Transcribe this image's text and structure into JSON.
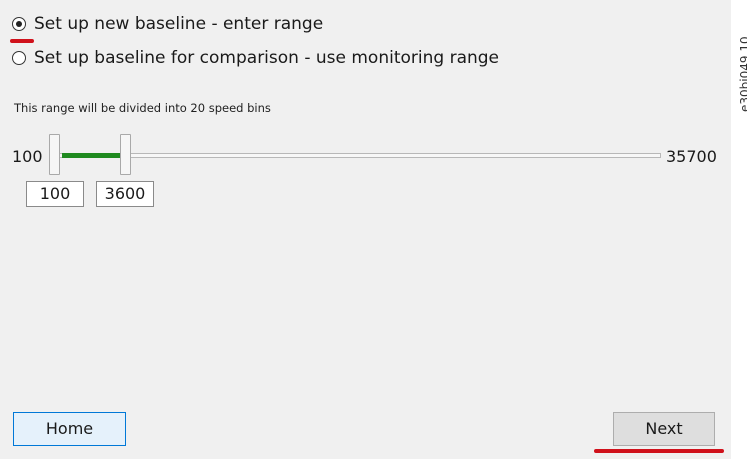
{
  "options": {
    "new_baseline_label": "Set up new baseline - enter range",
    "comparison_baseline_label": "Set up baseline for comparison - use monitoring range",
    "selected": "new_baseline"
  },
  "info_text": "This range will be divided into 20 speed bins",
  "range": {
    "min_label": "100",
    "max_label": "35700",
    "low_value": "100",
    "high_value": "3600"
  },
  "buttons": {
    "home_label": "Home",
    "next_label": "Next"
  },
  "figure_code": "e30bi049.10",
  "colors": {
    "track_fill": "#1f8a1f",
    "highlight_marks": "#d0111b",
    "home_border": "#0078d7"
  }
}
